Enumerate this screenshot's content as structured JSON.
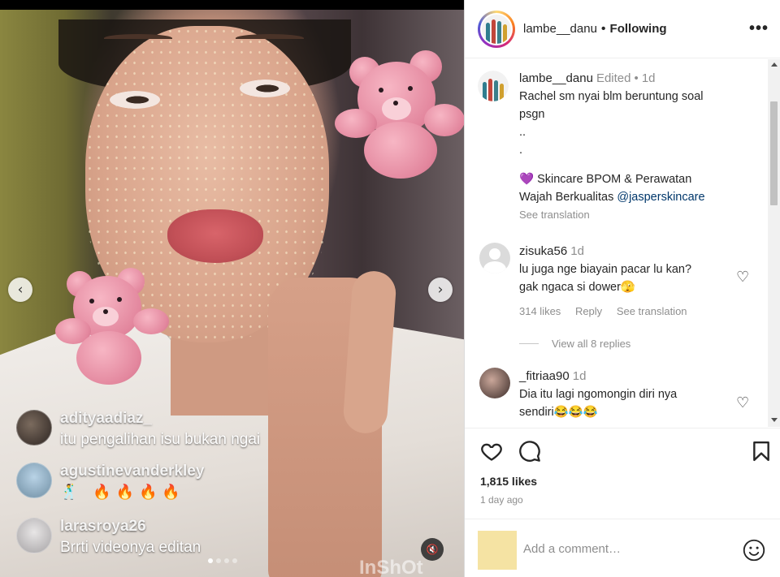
{
  "post": {
    "username": "lambe__danu",
    "separator": "•",
    "follow_status": "Following",
    "more_label": "•••"
  },
  "caption": {
    "username": "lambe__danu",
    "edited": "Edited",
    "dot": "•",
    "age": "1d",
    "line1": "Rachel sm nyai blm beruntung soal",
    "line2": "psgn",
    "line3": "..",
    "line4": ".",
    "promo_emoji": "💜",
    "promo_text1": "Skincare BPOM & Perawatan",
    "promo_text2": "Wajah Berkualitas",
    "promo_handle": "@jasperskincare",
    "see_translation": "See translation"
  },
  "comments": [
    {
      "username": "zisuka56",
      "age": "1d",
      "line1": "lu juga nge biayain pacar lu kan?",
      "line2": "gak ngaca si dower🫣",
      "likes": "314 likes",
      "reply": "Reply",
      "see_translation": "See translation",
      "view_replies": "View all 8 replies"
    },
    {
      "username": "_fitriaa90",
      "age": "1d",
      "line1": "Dia itu lagi ngomongin diri nya",
      "line2": "sendiri😂😂😂"
    }
  ],
  "media": {
    "live_comments": [
      {
        "username": "adityaadiaz_",
        "text": "itu pengalihan isu bukan ngai"
      },
      {
        "username": "agustinevanderkley",
        "text": "🔥🔥🔥🔥",
        "emoji_prefix": "🕺"
      },
      {
        "username": "larasroya26",
        "text": "Brrti videonya editan"
      }
    ],
    "prev_icon": "‹",
    "next_icon": "›",
    "sound_icon": "🔇",
    "watermark": "InShOt",
    "carousel_count": 4,
    "carousel_active": 0
  },
  "footer": {
    "likes": "1,815 likes",
    "time": "1 day ago",
    "comment_placeholder": "Add a comment…"
  },
  "colors": {
    "accent_link": "#00376b",
    "muted": "#8e8e8e",
    "text": "#262626"
  }
}
